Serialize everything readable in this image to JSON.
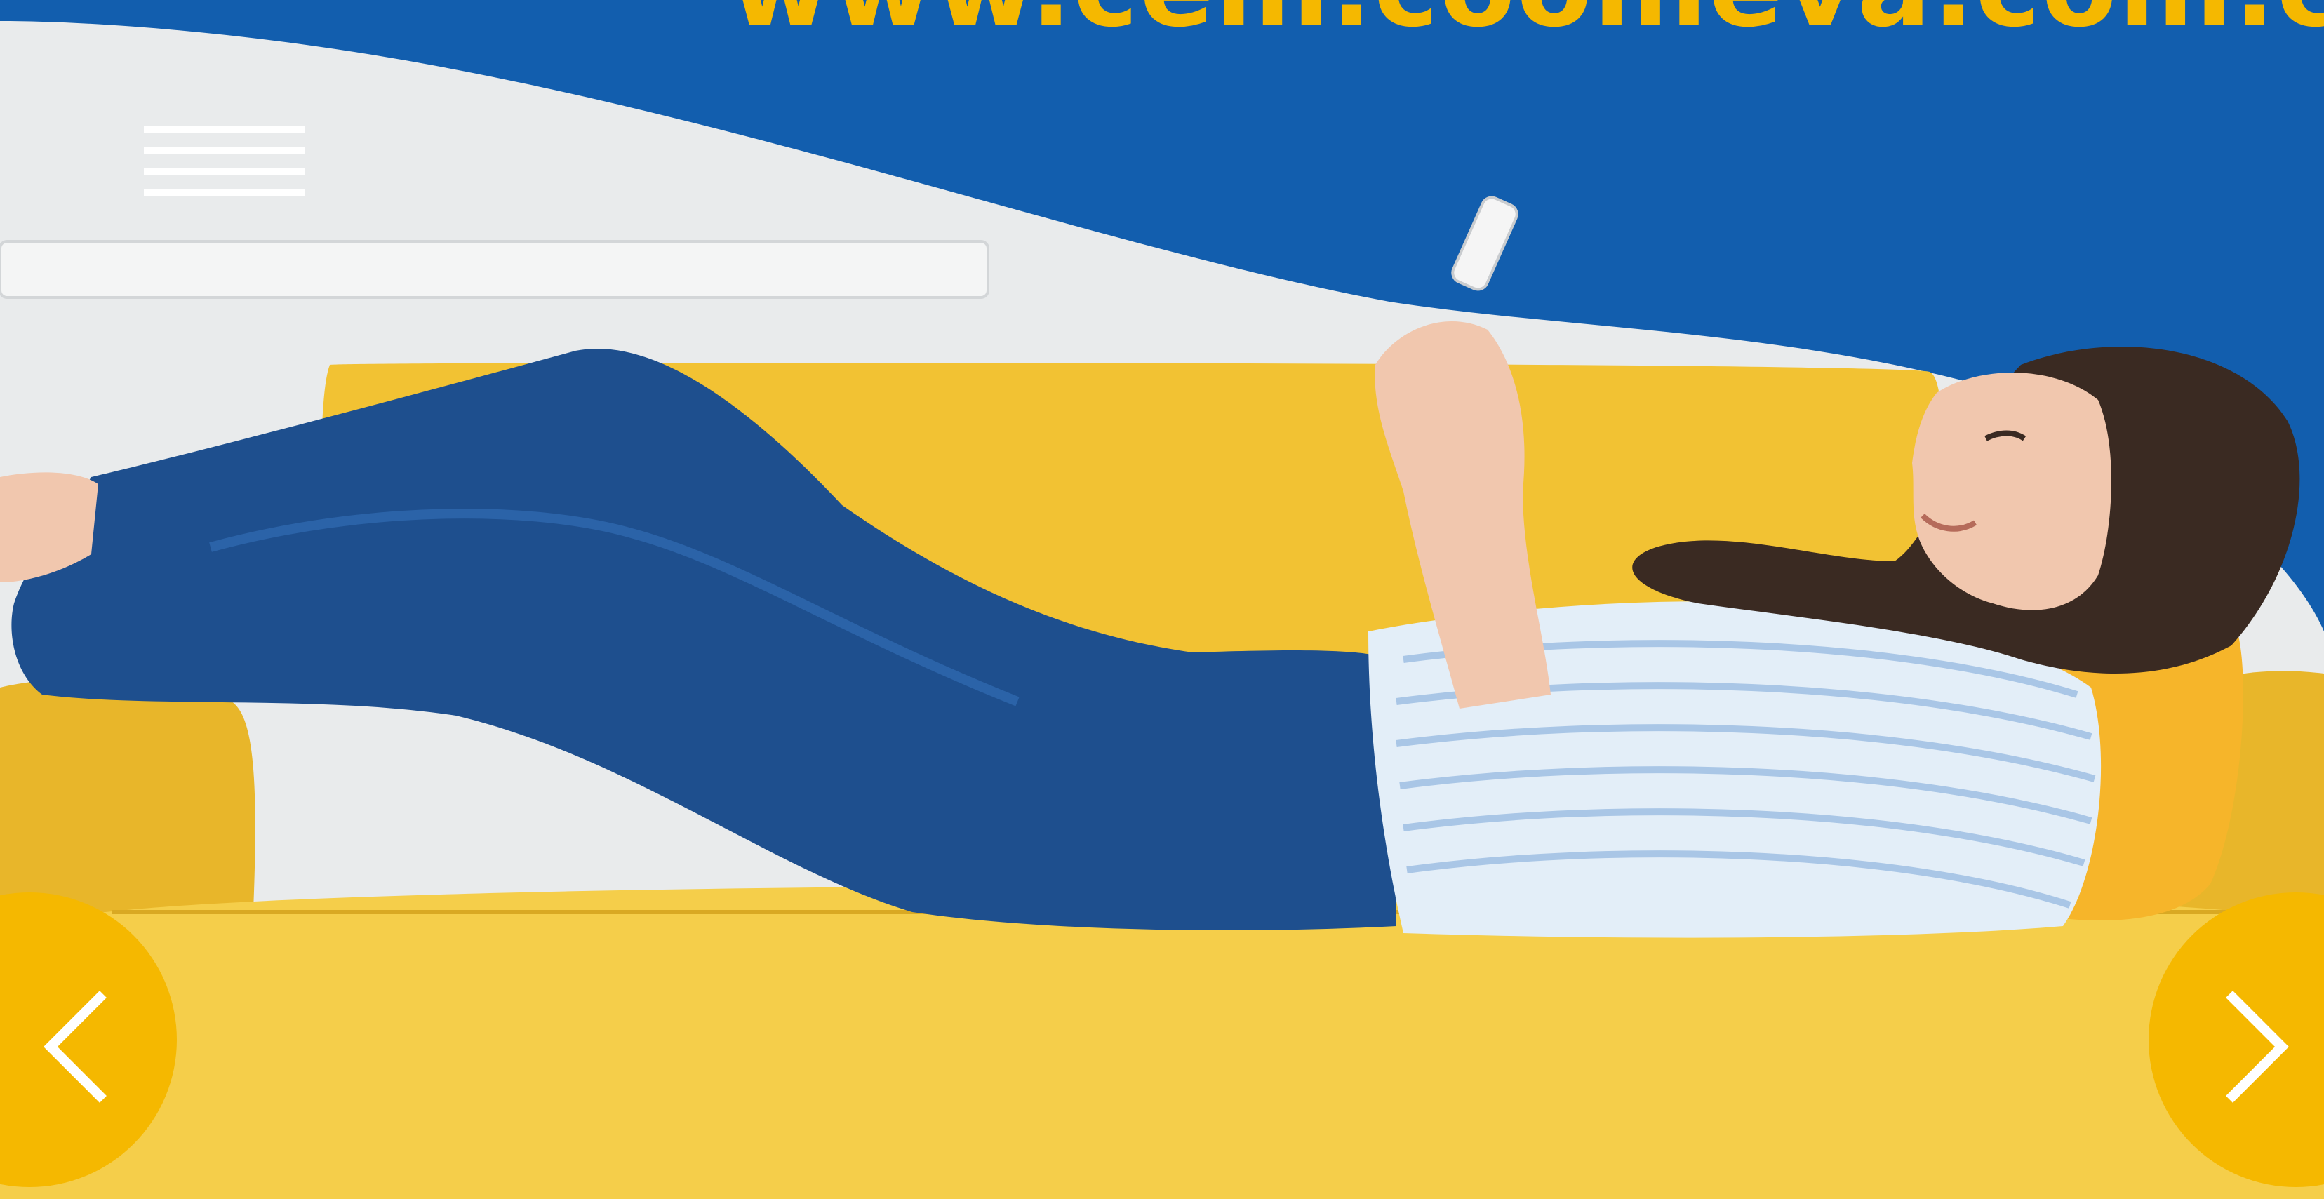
{
  "banner": {
    "url_text": "www.cem.coomeva.com.co"
  },
  "colors": {
    "brand_blue": "#125EAE",
    "brand_yellow": "#F5B800",
    "sofa_yellow": "#F2C233",
    "wall_grey": "#E9EBEC",
    "denim": "#1E4F8E",
    "shirt": "#E3EEF8",
    "hair": "#3A2A22",
    "skin": "#F1C7AE"
  },
  "controls": {
    "prev_icon": "chevron-left-icon",
    "next_icon": "chevron-right-icon",
    "menu_icon": "hamburger-menu-icon"
  }
}
